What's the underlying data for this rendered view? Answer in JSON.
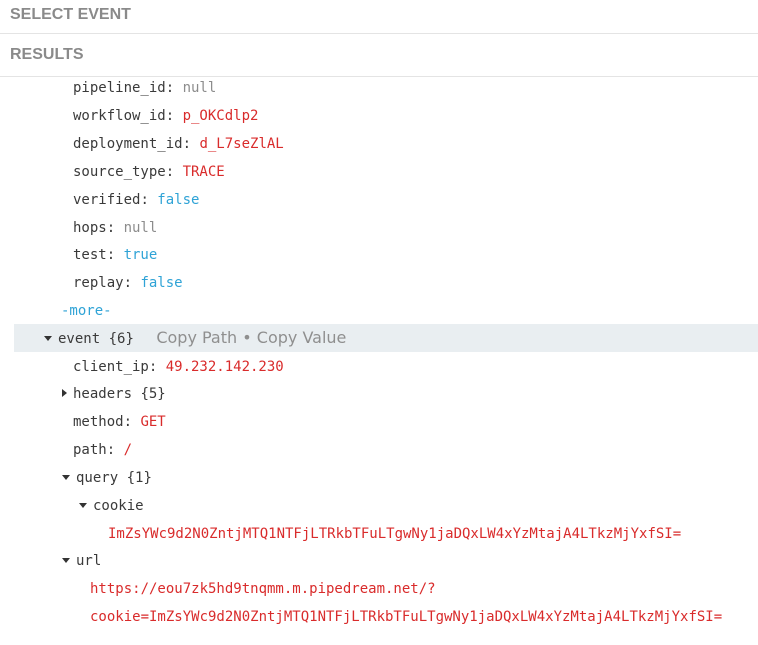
{
  "headers": {
    "select_event": "SELECT EVENT",
    "results": "RESULTS"
  },
  "fields": {
    "pipeline_id": {
      "key": "pipeline_id",
      "value": "null"
    },
    "workflow_id": {
      "key": "workflow_id",
      "value": "p_OKCdlp2"
    },
    "deployment_id": {
      "key": "deployment_id",
      "value": "d_L7seZlAL"
    },
    "source_type": {
      "key": "source_type",
      "value": "TRACE"
    },
    "verified": {
      "key": "verified",
      "value": "false"
    },
    "hops": {
      "key": "hops",
      "value": "null"
    },
    "test": {
      "key": "test",
      "value": "true"
    },
    "replay": {
      "key": "replay",
      "value": "false"
    }
  },
  "more_label": "-more-",
  "event": {
    "key": "event",
    "count": "{6}",
    "copy_path": "Copy Path",
    "separator": "•",
    "copy_value": "Copy Value",
    "client_ip": {
      "key": "client_ip",
      "value": "49.232.142.230"
    },
    "headers": {
      "key": "headers",
      "count": "{5}"
    },
    "method": {
      "key": "method",
      "value": "GET"
    },
    "path": {
      "key": "path",
      "value": "/"
    },
    "query": {
      "key": "query",
      "count": "{1}",
      "cookie": {
        "key": "cookie",
        "value": "ImZsYWc9d2N0ZntjMTQ1NTFjLTRkbTFuLTgwNy1jaDQxLW4xYzMtajA4LTkzMjYxfSI="
      }
    },
    "url": {
      "key": "url",
      "value_line1": "https://eou7zk5hd9tnqmm.m.pipedream.net/?",
      "value_line2": "cookie=ImZsYWc9d2N0ZntjMTQ1NTFjLTRkbTFuLTgwNy1jaDQxLW4xYzMtajA4LTkzMjYxfSI="
    }
  },
  "colors": {
    "string": "#d92b2b",
    "boolean": "#2fa3d6",
    "null": "#8c8c8c",
    "highlight": "#e9eef1",
    "header_text": "#8a8a8a"
  }
}
